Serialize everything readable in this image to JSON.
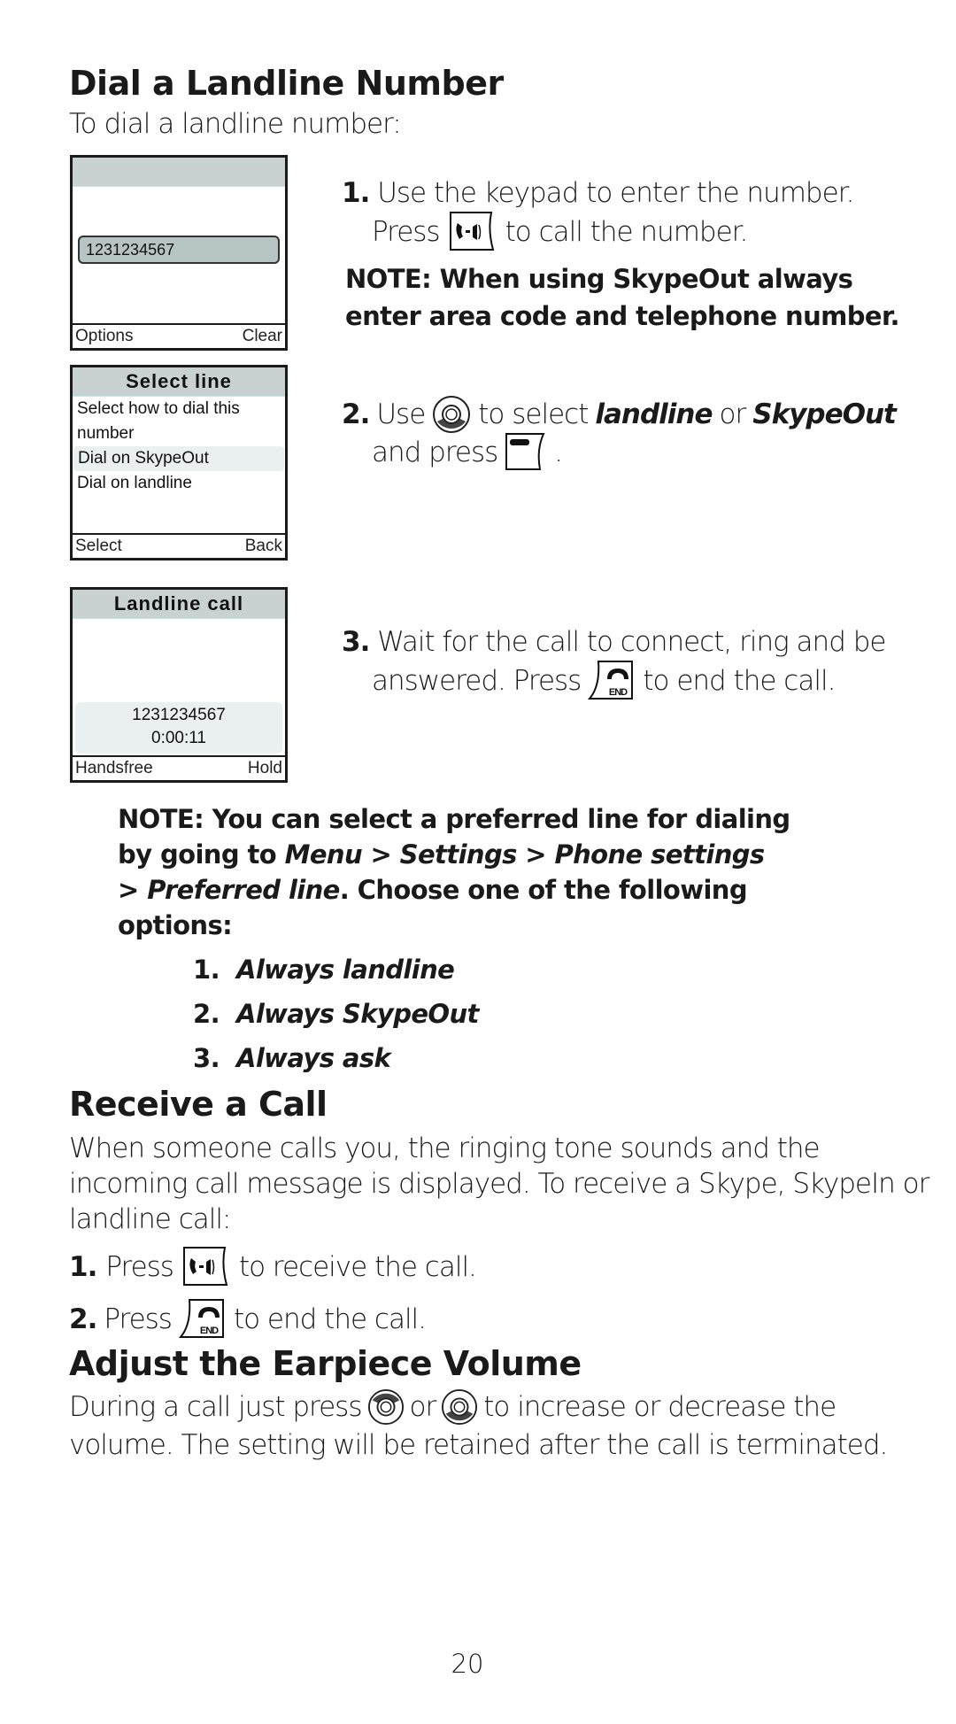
{
  "sections": {
    "dial": {
      "title": "Dial a Landline Number",
      "intro": "To dial a landline number:",
      "screen1": {
        "number": "1231234567",
        "softkey_left": "Options",
        "softkey_right": "Clear"
      },
      "screen2": {
        "title": "Select line",
        "line1": "Select how to dial this",
        "line2": "number",
        "option_highlighted": "Dial on SkypeOut",
        "option2": "Dial on landline",
        "softkey_left": "Select",
        "softkey_right": "Back"
      },
      "screen3": {
        "title": "Landline call",
        "number": "1231234567",
        "timer": "0:00:11",
        "softkey_left": "Handsfree",
        "softkey_right": "Hold"
      },
      "step1": {
        "num": "1.",
        "text_a": "Use the keypad to enter the number.",
        "text_b_pre": "Press",
        "text_b_post": "to call the number.",
        "icon": "talk-key-icon"
      },
      "note1_line1": "NOTE: When using SkypeOut always",
      "note1_line2": "enter area code and telephone number.",
      "step2": {
        "num": "2.",
        "pre": "Use",
        "mid": "to select",
        "em1": "landline",
        "or": "or",
        "em2": "SkypeOut",
        "line2_pre": "and press",
        "line2_post": "."
      },
      "step3": {
        "num": "3.",
        "line1": "Wait for the call to connect, ring and be",
        "line2_pre": "answered. Press",
        "line2_post": "to end the call."
      },
      "note2": {
        "l1": "NOTE: You can select a preferred line for dialing",
        "l2_pre": "by going to",
        "l2_em": "Menu > Settings > Phone settings",
        "l3_em": "> Preferred line",
        "l3_post": ". Choose one of the following",
        "l4": "options:"
      },
      "options": [
        {
          "num": "1.",
          "label": "Always landline"
        },
        {
          "num": "2.",
          "label": "Always SkypeOut"
        },
        {
          "num": "3.",
          "label": "Always ask"
        }
      ]
    },
    "receive": {
      "title": "Receive a Call",
      "p1": "When someone calls you, the ringing tone sounds and the",
      "p2": "incoming call message is displayed. To receive a Skype, SkypeIn or",
      "p3": "landline call:",
      "step1": {
        "num": "1.",
        "pre": "Press",
        "post": "to receive the call."
      },
      "step2": {
        "num": "2.",
        "pre": "Press",
        "post": "to end the call."
      }
    },
    "volume": {
      "title": "Adjust the Earpiece Volume",
      "l1_pre": "During a call just press",
      "l1_or": "or",
      "l1_post": "to increase or decrease the",
      "l2": "volume. The setting will be retained after the call is terminated."
    }
  },
  "page_number": "20",
  "colors": {
    "screen_header": "#c9d2d1",
    "number_field": "#b7c4c4",
    "highlight_row": "#eaf0ef",
    "text": "#1a1a1a"
  }
}
